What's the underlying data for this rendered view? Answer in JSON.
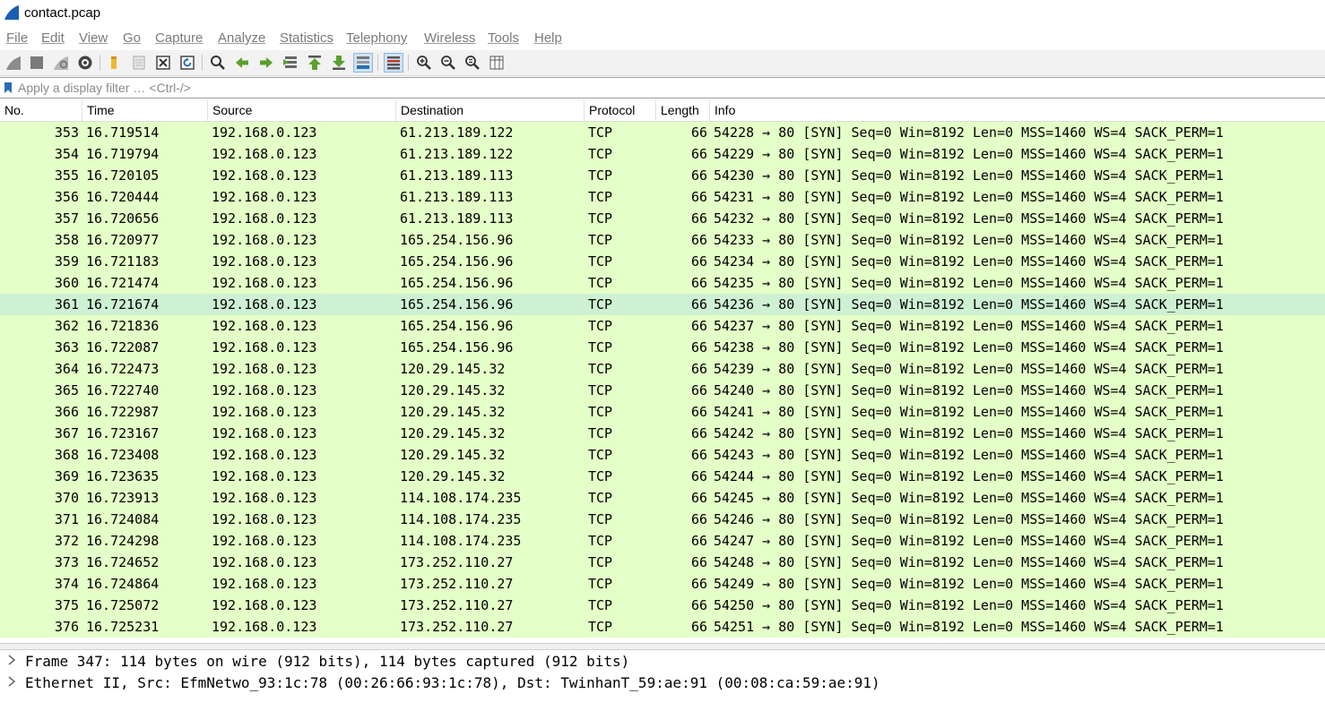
{
  "window": {
    "title": "contact.pcap"
  },
  "menu": [
    "File",
    "Edit",
    "View",
    "Go",
    "Capture",
    "Analyze",
    "Statistics",
    "Telephony",
    "Wireless",
    "Tools",
    "Help"
  ],
  "filter": {
    "placeholder": "Apply a display filter … <Ctrl-/>"
  },
  "columns": {
    "no": "No.",
    "time": "Time",
    "source": "Source",
    "destination": "Destination",
    "protocol": "Protocol",
    "length": "Length",
    "info": "Info"
  },
  "colors": {
    "tcp_row_bg": "#e4ffc7",
    "selected_row_bg": "#cef1d4"
  },
  "packets": [
    {
      "no": "353",
      "time": "16.719514",
      "src": "192.168.0.123",
      "dst": "61.213.189.122",
      "proto": "TCP",
      "len": "66",
      "info": "54228 → 80 [SYN] Seq=0 Win=8192 Len=0 MSS=1460 WS=4 SACK_PERM=1"
    },
    {
      "no": "354",
      "time": "16.719794",
      "src": "192.168.0.123",
      "dst": "61.213.189.122",
      "proto": "TCP",
      "len": "66",
      "info": "54229 → 80 [SYN] Seq=0 Win=8192 Len=0 MSS=1460 WS=4 SACK_PERM=1"
    },
    {
      "no": "355",
      "time": "16.720105",
      "src": "192.168.0.123",
      "dst": "61.213.189.113",
      "proto": "TCP",
      "len": "66",
      "info": "54230 → 80 [SYN] Seq=0 Win=8192 Len=0 MSS=1460 WS=4 SACK_PERM=1"
    },
    {
      "no": "356",
      "time": "16.720444",
      "src": "192.168.0.123",
      "dst": "61.213.189.113",
      "proto": "TCP",
      "len": "66",
      "info": "54231 → 80 [SYN] Seq=0 Win=8192 Len=0 MSS=1460 WS=4 SACK_PERM=1"
    },
    {
      "no": "357",
      "time": "16.720656",
      "src": "192.168.0.123",
      "dst": "61.213.189.113",
      "proto": "TCP",
      "len": "66",
      "info": "54232 → 80 [SYN] Seq=0 Win=8192 Len=0 MSS=1460 WS=4 SACK_PERM=1"
    },
    {
      "no": "358",
      "time": "16.720977",
      "src": "192.168.0.123",
      "dst": "165.254.156.96",
      "proto": "TCP",
      "len": "66",
      "info": "54233 → 80 [SYN] Seq=0 Win=8192 Len=0 MSS=1460 WS=4 SACK_PERM=1"
    },
    {
      "no": "359",
      "time": "16.721183",
      "src": "192.168.0.123",
      "dst": "165.254.156.96",
      "proto": "TCP",
      "len": "66",
      "info": "54234 → 80 [SYN] Seq=0 Win=8192 Len=0 MSS=1460 WS=4 SACK_PERM=1"
    },
    {
      "no": "360",
      "time": "16.721474",
      "src": "192.168.0.123",
      "dst": "165.254.156.96",
      "proto": "TCP",
      "len": "66",
      "info": "54235 → 80 [SYN] Seq=0 Win=8192 Len=0 MSS=1460 WS=4 SACK_PERM=1"
    },
    {
      "no": "361",
      "time": "16.721674",
      "src": "192.168.0.123",
      "dst": "165.254.156.96",
      "proto": "TCP",
      "len": "66",
      "info": "54236 → 80 [SYN] Seq=0 Win=8192 Len=0 MSS=1460 WS=4 SACK_PERM=1",
      "selected": true
    },
    {
      "no": "362",
      "time": "16.721836",
      "src": "192.168.0.123",
      "dst": "165.254.156.96",
      "proto": "TCP",
      "len": "66",
      "info": "54237 → 80 [SYN] Seq=0 Win=8192 Len=0 MSS=1460 WS=4 SACK_PERM=1"
    },
    {
      "no": "363",
      "time": "16.722087",
      "src": "192.168.0.123",
      "dst": "165.254.156.96",
      "proto": "TCP",
      "len": "66",
      "info": "54238 → 80 [SYN] Seq=0 Win=8192 Len=0 MSS=1460 WS=4 SACK_PERM=1"
    },
    {
      "no": "364",
      "time": "16.722473",
      "src": "192.168.0.123",
      "dst": "120.29.145.32",
      "proto": "TCP",
      "len": "66",
      "info": "54239 → 80 [SYN] Seq=0 Win=8192 Len=0 MSS=1460 WS=4 SACK_PERM=1"
    },
    {
      "no": "365",
      "time": "16.722740",
      "src": "192.168.0.123",
      "dst": "120.29.145.32",
      "proto": "TCP",
      "len": "66",
      "info": "54240 → 80 [SYN] Seq=0 Win=8192 Len=0 MSS=1460 WS=4 SACK_PERM=1"
    },
    {
      "no": "366",
      "time": "16.722987",
      "src": "192.168.0.123",
      "dst": "120.29.145.32",
      "proto": "TCP",
      "len": "66",
      "info": "54241 → 80 [SYN] Seq=0 Win=8192 Len=0 MSS=1460 WS=4 SACK_PERM=1"
    },
    {
      "no": "367",
      "time": "16.723167",
      "src": "192.168.0.123",
      "dst": "120.29.145.32",
      "proto": "TCP",
      "len": "66",
      "info": "54242 → 80 [SYN] Seq=0 Win=8192 Len=0 MSS=1460 WS=4 SACK_PERM=1"
    },
    {
      "no": "368",
      "time": "16.723408",
      "src": "192.168.0.123",
      "dst": "120.29.145.32",
      "proto": "TCP",
      "len": "66",
      "info": "54243 → 80 [SYN] Seq=0 Win=8192 Len=0 MSS=1460 WS=4 SACK_PERM=1"
    },
    {
      "no": "369",
      "time": "16.723635",
      "src": "192.168.0.123",
      "dst": "120.29.145.32",
      "proto": "TCP",
      "len": "66",
      "info": "54244 → 80 [SYN] Seq=0 Win=8192 Len=0 MSS=1460 WS=4 SACK_PERM=1"
    },
    {
      "no": "370",
      "time": "16.723913",
      "src": "192.168.0.123",
      "dst": "114.108.174.235",
      "proto": "TCP",
      "len": "66",
      "info": "54245 → 80 [SYN] Seq=0 Win=8192 Len=0 MSS=1460 WS=4 SACK_PERM=1"
    },
    {
      "no": "371",
      "time": "16.724084",
      "src": "192.168.0.123",
      "dst": "114.108.174.235",
      "proto": "TCP",
      "len": "66",
      "info": "54246 → 80 [SYN] Seq=0 Win=8192 Len=0 MSS=1460 WS=4 SACK_PERM=1"
    },
    {
      "no": "372",
      "time": "16.724298",
      "src": "192.168.0.123",
      "dst": "114.108.174.235",
      "proto": "TCP",
      "len": "66",
      "info": "54247 → 80 [SYN] Seq=0 Win=8192 Len=0 MSS=1460 WS=4 SACK_PERM=1"
    },
    {
      "no": "373",
      "time": "16.724652",
      "src": "192.168.0.123",
      "dst": "173.252.110.27",
      "proto": "TCP",
      "len": "66",
      "info": "54248 → 80 [SYN] Seq=0 Win=8192 Len=0 MSS=1460 WS=4 SACK_PERM=1"
    },
    {
      "no": "374",
      "time": "16.724864",
      "src": "192.168.0.123",
      "dst": "173.252.110.27",
      "proto": "TCP",
      "len": "66",
      "info": "54249 → 80 [SYN] Seq=0 Win=8192 Len=0 MSS=1460 WS=4 SACK_PERM=1"
    },
    {
      "no": "375",
      "time": "16.725072",
      "src": "192.168.0.123",
      "dst": "173.252.110.27",
      "proto": "TCP",
      "len": "66",
      "info": "54250 → 80 [SYN] Seq=0 Win=8192 Len=0 MSS=1460 WS=4 SACK_PERM=1"
    },
    {
      "no": "376",
      "time": "16.725231",
      "src": "192.168.0.123",
      "dst": "173.252.110.27",
      "proto": "TCP",
      "len": "66",
      "info": "54251 → 80 [SYN] Seq=0 Win=8192 Len=0 MSS=1460 WS=4 SACK_PERM=1"
    }
  ],
  "details": [
    "Frame 347: 114 bytes on wire (912 bits), 114 bytes captured (912 bits)",
    "Ethernet II, Src: EfmNetwo_93:1c:78 (00:26:66:93:1c:78), Dst: TwinhanT_59:ae:91 (00:08:ca:59:ae:91)"
  ],
  "toolbar": {
    "icons": [
      "shark-fin-start-icon",
      "stop-square-icon",
      "restart-fin-icon",
      "capture-options-gear-icon",
      "open-file-icon",
      "save-file-icon",
      "close-file-icon",
      "reload-file-icon",
      "find-packet-magnifier-icon",
      "go-back-arrow-icon",
      "go-forward-arrow-icon",
      "go-to-packet-icon",
      "go-to-first-packet-icon",
      "go-to-last-packet-icon",
      "autoscroll-icon",
      "colorize-icon",
      "zoom-in-icon",
      "zoom-out-icon",
      "normal-size-icon",
      "resize-columns-icon"
    ]
  }
}
